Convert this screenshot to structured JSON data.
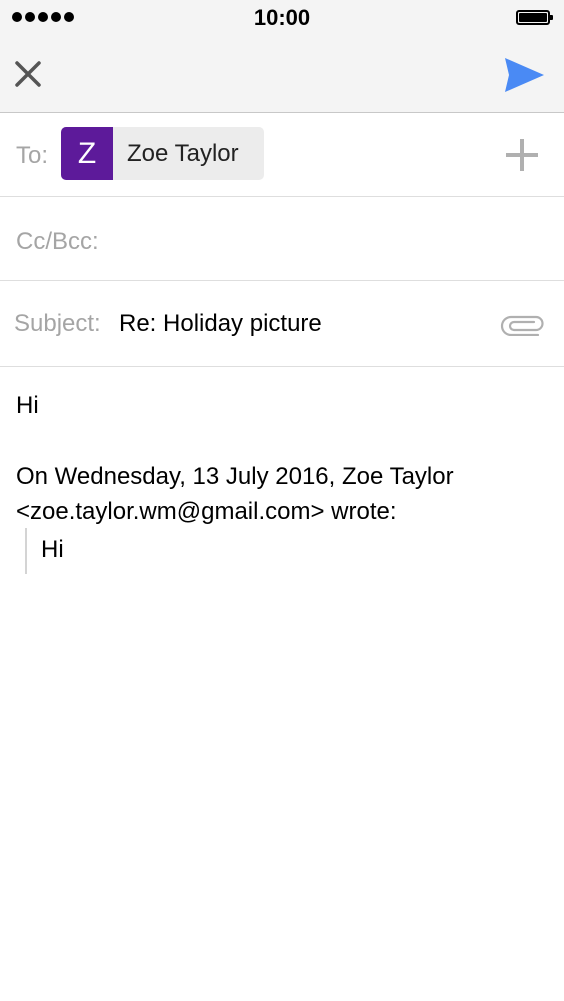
{
  "status_bar": {
    "time": "10:00",
    "signal_bars": 5,
    "battery_level": 1.0
  },
  "toolbar": {
    "close_icon": "close-icon",
    "send_icon": "send-icon",
    "send_color": "#4a8af4"
  },
  "to_field": {
    "label": "To:",
    "recipient": {
      "initial": "Z",
      "name": "Zoe Taylor",
      "avatar_color": "#5d1a9a"
    },
    "add_icon": "plus-icon"
  },
  "cc_field": {
    "label": "Cc/Bcc:",
    "value": ""
  },
  "subject_field": {
    "label": "Subject:",
    "value": "Re: Holiday picture",
    "attach_icon": "paperclip-icon"
  },
  "body": {
    "text": "Hi",
    "quote_header_line1": "On Wednesday, 13 July 2016, Zoe Taylor",
    "quote_header_line2": "<zoe.taylor.wm@gmail.com> wrote:",
    "quoted_text": "Hi"
  }
}
